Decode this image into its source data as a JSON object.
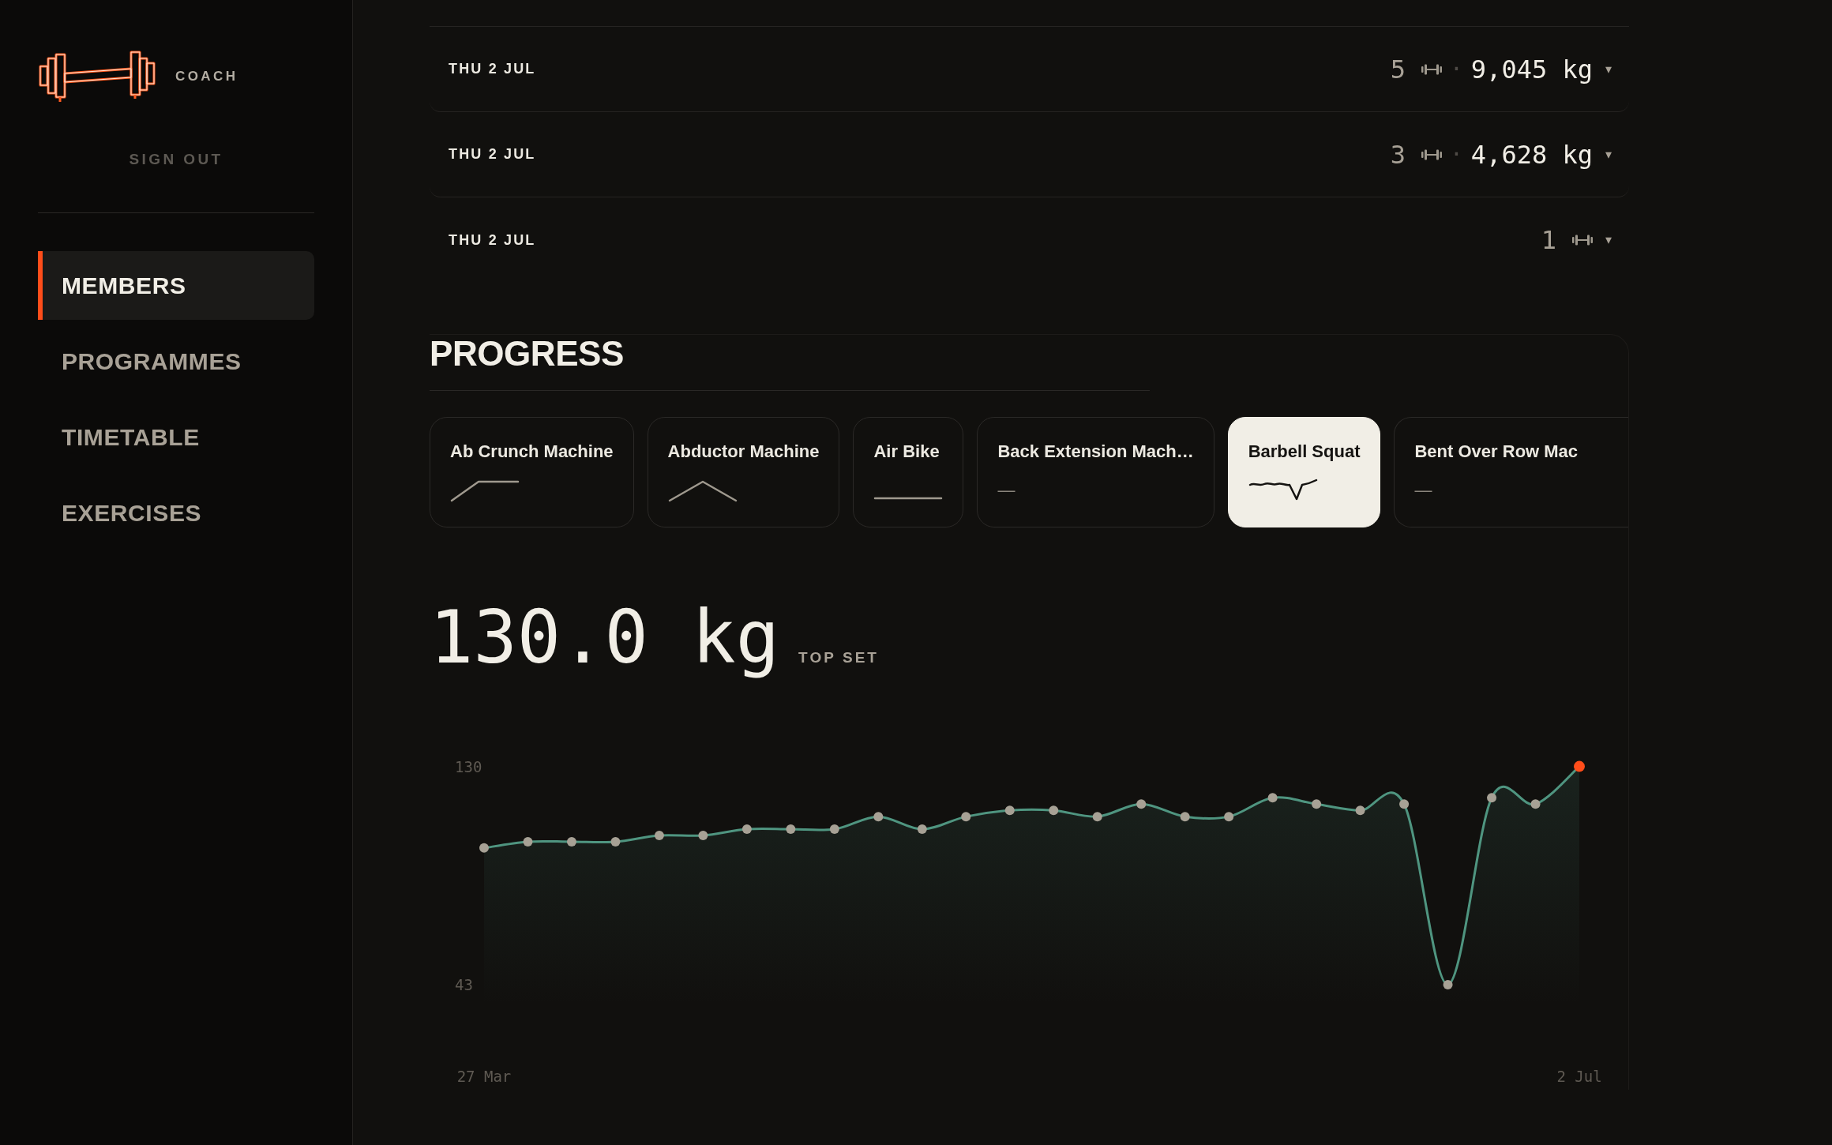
{
  "sidebar": {
    "brand": "COACH",
    "sign_out": "SIGN OUT",
    "nav": [
      {
        "label": "MEMBERS",
        "selected": true
      },
      {
        "label": "PROGRAMMES",
        "selected": false
      },
      {
        "label": "TIMETABLE",
        "selected": false
      },
      {
        "label": "EXERCISES",
        "selected": false
      }
    ]
  },
  "sessions": [
    {
      "date": "THU 2 JUL",
      "count": "5",
      "separator": "·",
      "volume": "9,045 kg",
      "caret": "▾",
      "expanded": false
    },
    {
      "date": "THU 2 JUL",
      "count": "3",
      "separator": "·",
      "volume": "4,628 kg",
      "caret": "▾",
      "expanded": false
    },
    {
      "date": "THU 2 JUL",
      "count": "1",
      "caret": "▾",
      "expanded": false
    }
  ],
  "progress": {
    "title": "PROGRESS",
    "exercises": [
      {
        "name": "Ab Crunch Machine",
        "kind": "rise",
        "selected": false
      },
      {
        "name": "Abductor Machine",
        "kind": "peak",
        "selected": false
      },
      {
        "name": "Air Bike",
        "kind": "flat",
        "selected": false
      },
      {
        "name": "Back Extension Mach…",
        "kind": "empty",
        "mark": "—",
        "selected": false
      },
      {
        "name": "Barbell Squat",
        "kind": "dip",
        "selected": true
      },
      {
        "name": "Bent Over Row Mac",
        "kind": "empty",
        "mark": "—",
        "selected": false
      }
    ],
    "summary": {
      "value": "130.0 kg",
      "label": "TOP SET"
    },
    "chart_data": {
      "type": "area",
      "categories": [
        "27 Mar",
        null,
        null,
        null,
        null,
        null,
        null,
        null,
        null,
        null,
        null,
        null,
        null,
        null,
        null,
        null,
        null,
        null,
        null,
        null,
        null,
        null,
        null,
        null,
        null,
        "2 Jul"
      ],
      "series": [
        {
          "color": "#4f9580",
          "values": [
            97.5,
            100,
            100,
            100,
            102.5,
            102.5,
            105,
            105,
            105,
            110,
            105,
            110,
            112.5,
            112.5,
            110,
            115,
            110,
            110,
            117.5,
            115,
            112.5,
            115,
            43,
            117.5,
            115,
            130
          ]
        }
      ],
      "ylim": [
        43,
        130
      ],
      "yticks": [
        43,
        130
      ]
    }
  }
}
